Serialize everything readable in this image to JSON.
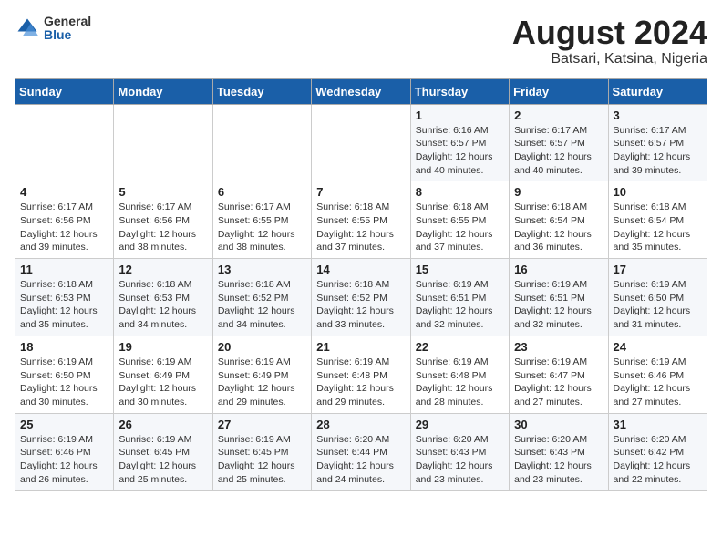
{
  "header": {
    "logo_general": "General",
    "logo_blue": "Blue",
    "month_year": "August 2024",
    "location": "Batsari, Katsina, Nigeria"
  },
  "weekdays": [
    "Sunday",
    "Monday",
    "Tuesday",
    "Wednesday",
    "Thursday",
    "Friday",
    "Saturday"
  ],
  "weeks": [
    [
      {
        "day": "",
        "info": ""
      },
      {
        "day": "",
        "info": ""
      },
      {
        "day": "",
        "info": ""
      },
      {
        "day": "",
        "info": ""
      },
      {
        "day": "1",
        "info": "Sunrise: 6:16 AM\nSunset: 6:57 PM\nDaylight: 12 hours\nand 40 minutes."
      },
      {
        "day": "2",
        "info": "Sunrise: 6:17 AM\nSunset: 6:57 PM\nDaylight: 12 hours\nand 40 minutes."
      },
      {
        "day": "3",
        "info": "Sunrise: 6:17 AM\nSunset: 6:57 PM\nDaylight: 12 hours\nand 39 minutes."
      }
    ],
    [
      {
        "day": "4",
        "info": "Sunrise: 6:17 AM\nSunset: 6:56 PM\nDaylight: 12 hours\nand 39 minutes."
      },
      {
        "day": "5",
        "info": "Sunrise: 6:17 AM\nSunset: 6:56 PM\nDaylight: 12 hours\nand 38 minutes."
      },
      {
        "day": "6",
        "info": "Sunrise: 6:17 AM\nSunset: 6:55 PM\nDaylight: 12 hours\nand 38 minutes."
      },
      {
        "day": "7",
        "info": "Sunrise: 6:18 AM\nSunset: 6:55 PM\nDaylight: 12 hours\nand 37 minutes."
      },
      {
        "day": "8",
        "info": "Sunrise: 6:18 AM\nSunset: 6:55 PM\nDaylight: 12 hours\nand 37 minutes."
      },
      {
        "day": "9",
        "info": "Sunrise: 6:18 AM\nSunset: 6:54 PM\nDaylight: 12 hours\nand 36 minutes."
      },
      {
        "day": "10",
        "info": "Sunrise: 6:18 AM\nSunset: 6:54 PM\nDaylight: 12 hours\nand 35 minutes."
      }
    ],
    [
      {
        "day": "11",
        "info": "Sunrise: 6:18 AM\nSunset: 6:53 PM\nDaylight: 12 hours\nand 35 minutes."
      },
      {
        "day": "12",
        "info": "Sunrise: 6:18 AM\nSunset: 6:53 PM\nDaylight: 12 hours\nand 34 minutes."
      },
      {
        "day": "13",
        "info": "Sunrise: 6:18 AM\nSunset: 6:52 PM\nDaylight: 12 hours\nand 34 minutes."
      },
      {
        "day": "14",
        "info": "Sunrise: 6:18 AM\nSunset: 6:52 PM\nDaylight: 12 hours\nand 33 minutes."
      },
      {
        "day": "15",
        "info": "Sunrise: 6:19 AM\nSunset: 6:51 PM\nDaylight: 12 hours\nand 32 minutes."
      },
      {
        "day": "16",
        "info": "Sunrise: 6:19 AM\nSunset: 6:51 PM\nDaylight: 12 hours\nand 32 minutes."
      },
      {
        "day": "17",
        "info": "Sunrise: 6:19 AM\nSunset: 6:50 PM\nDaylight: 12 hours\nand 31 minutes."
      }
    ],
    [
      {
        "day": "18",
        "info": "Sunrise: 6:19 AM\nSunset: 6:50 PM\nDaylight: 12 hours\nand 30 minutes."
      },
      {
        "day": "19",
        "info": "Sunrise: 6:19 AM\nSunset: 6:49 PM\nDaylight: 12 hours\nand 30 minutes."
      },
      {
        "day": "20",
        "info": "Sunrise: 6:19 AM\nSunset: 6:49 PM\nDaylight: 12 hours\nand 29 minutes."
      },
      {
        "day": "21",
        "info": "Sunrise: 6:19 AM\nSunset: 6:48 PM\nDaylight: 12 hours\nand 29 minutes."
      },
      {
        "day": "22",
        "info": "Sunrise: 6:19 AM\nSunset: 6:48 PM\nDaylight: 12 hours\nand 28 minutes."
      },
      {
        "day": "23",
        "info": "Sunrise: 6:19 AM\nSunset: 6:47 PM\nDaylight: 12 hours\nand 27 minutes."
      },
      {
        "day": "24",
        "info": "Sunrise: 6:19 AM\nSunset: 6:46 PM\nDaylight: 12 hours\nand 27 minutes."
      }
    ],
    [
      {
        "day": "25",
        "info": "Sunrise: 6:19 AM\nSunset: 6:46 PM\nDaylight: 12 hours\nand 26 minutes."
      },
      {
        "day": "26",
        "info": "Sunrise: 6:19 AM\nSunset: 6:45 PM\nDaylight: 12 hours\nand 25 minutes."
      },
      {
        "day": "27",
        "info": "Sunrise: 6:19 AM\nSunset: 6:45 PM\nDaylight: 12 hours\nand 25 minutes."
      },
      {
        "day": "28",
        "info": "Sunrise: 6:20 AM\nSunset: 6:44 PM\nDaylight: 12 hours\nand 24 minutes."
      },
      {
        "day": "29",
        "info": "Sunrise: 6:20 AM\nSunset: 6:43 PM\nDaylight: 12 hours\nand 23 minutes."
      },
      {
        "day": "30",
        "info": "Sunrise: 6:20 AM\nSunset: 6:43 PM\nDaylight: 12 hours\nand 23 minutes."
      },
      {
        "day": "31",
        "info": "Sunrise: 6:20 AM\nSunset: 6:42 PM\nDaylight: 12 hours\nand 22 minutes."
      }
    ]
  ]
}
